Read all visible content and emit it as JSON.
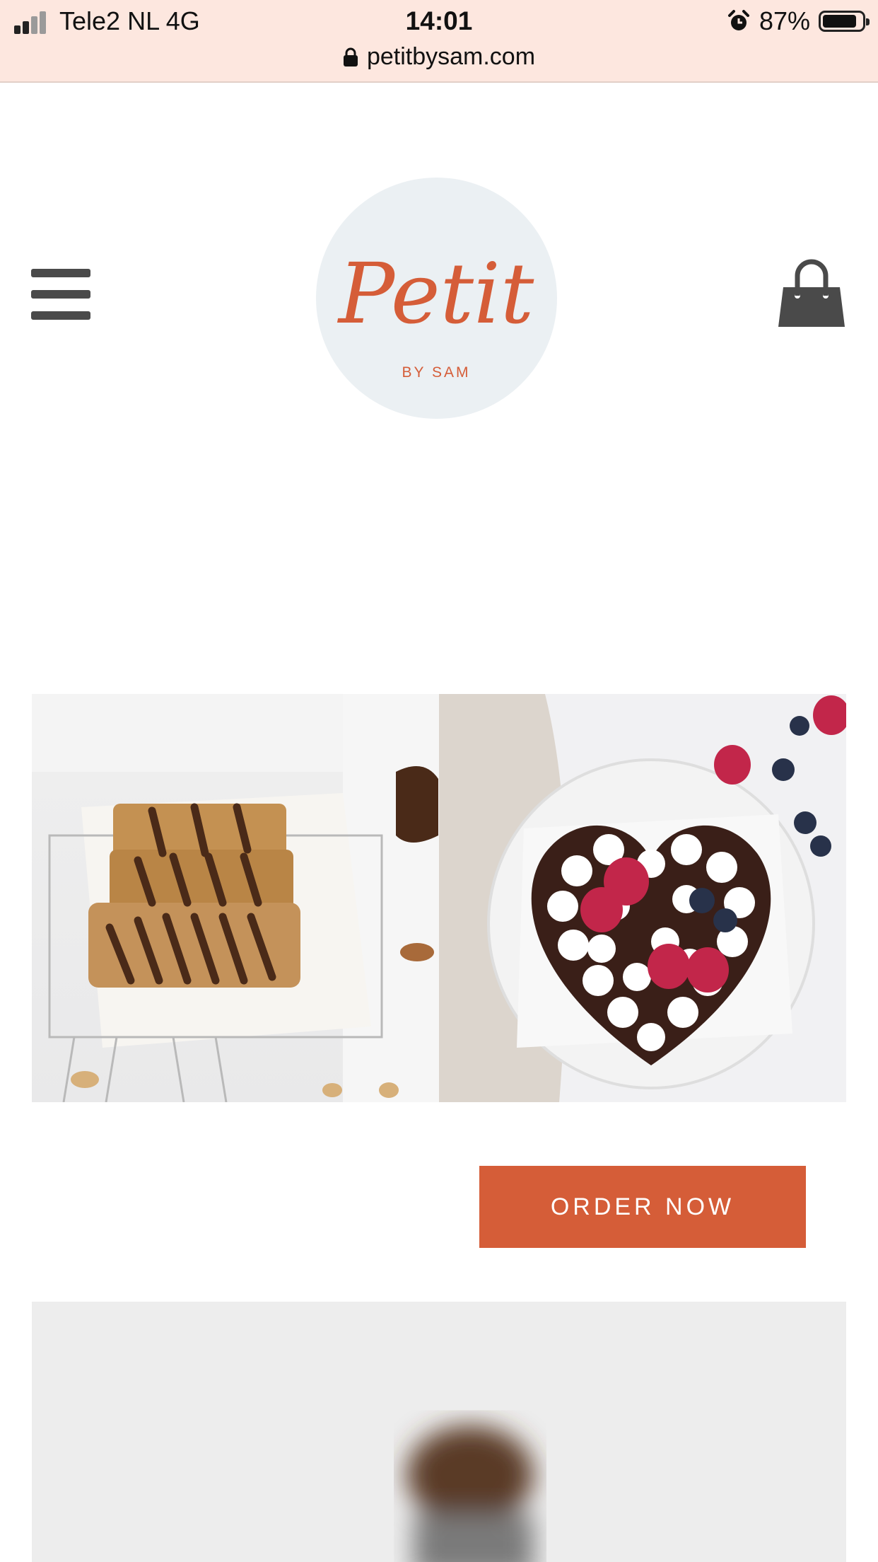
{
  "status_bar": {
    "carrier": "Tele2 NL   4G",
    "time": "14:01",
    "battery": "87%",
    "battery_level": 0.87,
    "url": "petitbysam.com",
    "icons": [
      "signal-icon",
      "alarm-icon",
      "battery-icon",
      "lock-icon"
    ]
  },
  "header": {
    "logo_title": "Petit",
    "logo_subtitle": "BY SAM",
    "menu_icon": "hamburger-icon",
    "cart_icon": "shopping-bag-icon"
  },
  "colors": {
    "accent": "#d55d38",
    "status_bar_bg": "#fde7df",
    "logo_bg": "#ebf0f3",
    "icon_gray": "#4a4a4a"
  },
  "gallery": [
    {
      "subject": "granola-bars-image"
    },
    {
      "subject": "heart-cake-image"
    }
  ],
  "cta": {
    "label": "ORDER NOW"
  }
}
